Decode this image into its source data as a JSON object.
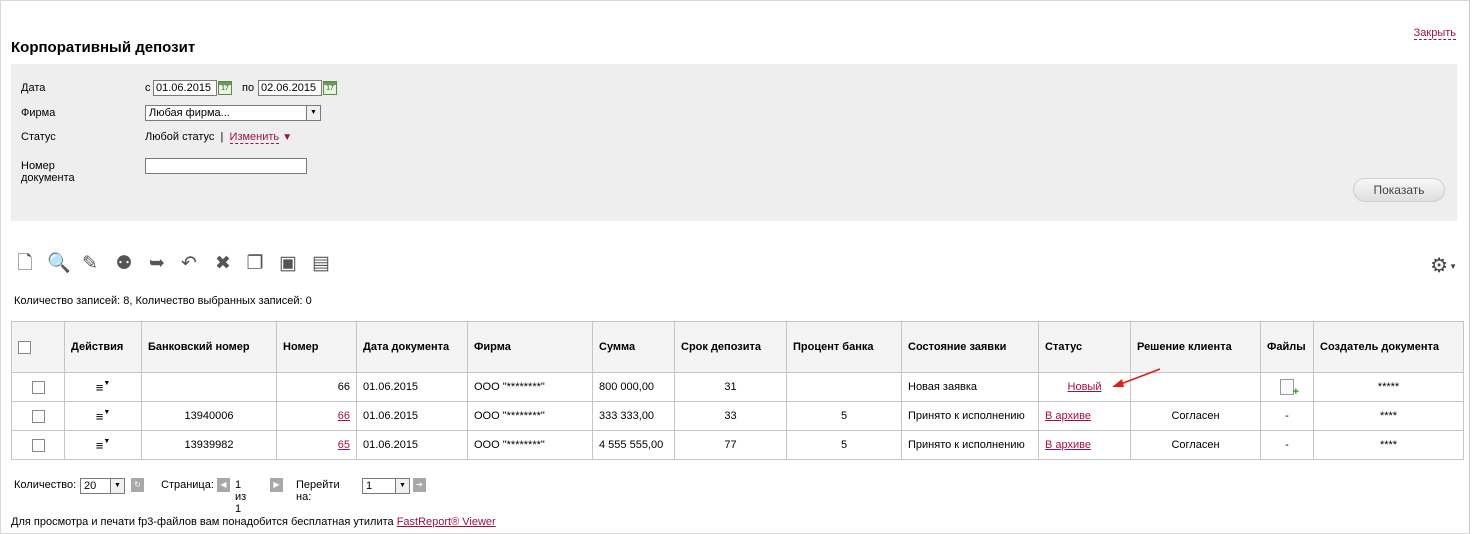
{
  "header": {
    "title": "Корпоративный депозит",
    "close_label": "Закрыть"
  },
  "filter": {
    "date_label": "Дата",
    "from_prefix": "с",
    "from_value": "01.06.2015",
    "to_prefix": "по",
    "to_value": "02.06.2015",
    "firm_label": "Фирма",
    "firm_value": "Любая фирма...",
    "status_label": "Статус",
    "status_value": "Любой статус",
    "status_sep": "|",
    "status_change": "Изменить",
    "docnum_label": "Номер документа",
    "docnum_value": "",
    "show_button": "Показать"
  },
  "toolbar": {
    "icons": [
      "new-document-icon",
      "search-icon",
      "edit-icon",
      "sign-icon",
      "send-icon",
      "recall-icon",
      "delete-icon",
      "copy-icon",
      "print-icon",
      "export-icon"
    ],
    "settings_icon": "gear-icon"
  },
  "records_info": "Количество записей: 8, Количество выбранных записей: 0",
  "table": {
    "columns": [
      "Действия",
      "Банковский номер",
      "Номер",
      "Дата документа",
      "Фирма",
      "Сумма",
      "Срок депозита",
      "Процент банка",
      "Состояние заявки",
      "Статус",
      "Решение клиента",
      "Файлы",
      "Создатель документа"
    ],
    "rows": [
      {
        "bank_no": "",
        "number": "66",
        "date": "01.06.2015",
        "firm": "ООО \"********\"",
        "sum": "800 000,00",
        "term": "31",
        "percent": "",
        "state": "Новая заявка",
        "status": "Новый",
        "decision": "",
        "files": "",
        "creator": "*****"
      },
      {
        "bank_no": "13940006",
        "number": "66",
        "date": "01.06.2015",
        "firm": "ООО \"********\"",
        "sum": "333 333,00",
        "term": "33",
        "percent": "5",
        "state": "Принято к исполнению",
        "status": "В архиве",
        "decision": "Согласен",
        "files": "-",
        "creator": "****"
      },
      {
        "bank_no": "13939982",
        "number": "65",
        "date": "01.06.2015",
        "firm": "ООО \"********\"",
        "sum": "4 555 555,00",
        "term": "77",
        "percent": "5",
        "state": "Принято к исполнению",
        "status": "В архиве",
        "decision": "Согласен",
        "files": "-",
        "creator": "****"
      }
    ]
  },
  "pager": {
    "count_label": "Количество:",
    "count_value": "20",
    "page_label": "Страница:",
    "page_text": "1 из 1",
    "goto_label": "Перейти на:",
    "goto_value": "1"
  },
  "footer": {
    "text": "Для просмотра и печати fp3-файлов вам понадобится бесплатная утилита",
    "link": "FastReport® Viewer"
  },
  "colors": {
    "link": "#a0123c",
    "filter_bg": "#eeeeee",
    "arrow": "#e02020"
  }
}
